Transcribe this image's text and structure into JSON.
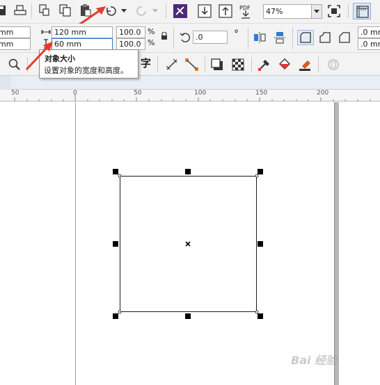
{
  "toolbar": {
    "zoom_value": "47%",
    "pdf_label": "PDF",
    "char_icon_label": "字"
  },
  "property_bar": {
    "x_value_partial": "mm",
    "y_value_partial": "mm",
    "width_value": "120 mm",
    "height_value": "60 mm",
    "scale_x": "100.0",
    "scale_y": "100.0",
    "percent_x": "%",
    "percent_y": "%",
    "rotation_value": ".0",
    "degree_symbol": "°",
    "corner_top": ".0 mm",
    "corner_bottom": ".0 mm"
  },
  "tooltip": {
    "title": "对象大小",
    "body": "设置对象的宽度和高度。"
  },
  "ruler": {
    "ticks": [
      "50",
      "0",
      "50",
      "100",
      "150",
      "200"
    ]
  },
  "watermark": "Bai 经验",
  "colors": {
    "accent_arrow": "#e8372d",
    "active_field_border": "#2b7cd3",
    "toolbar_bg": "#f3f3f3"
  }
}
